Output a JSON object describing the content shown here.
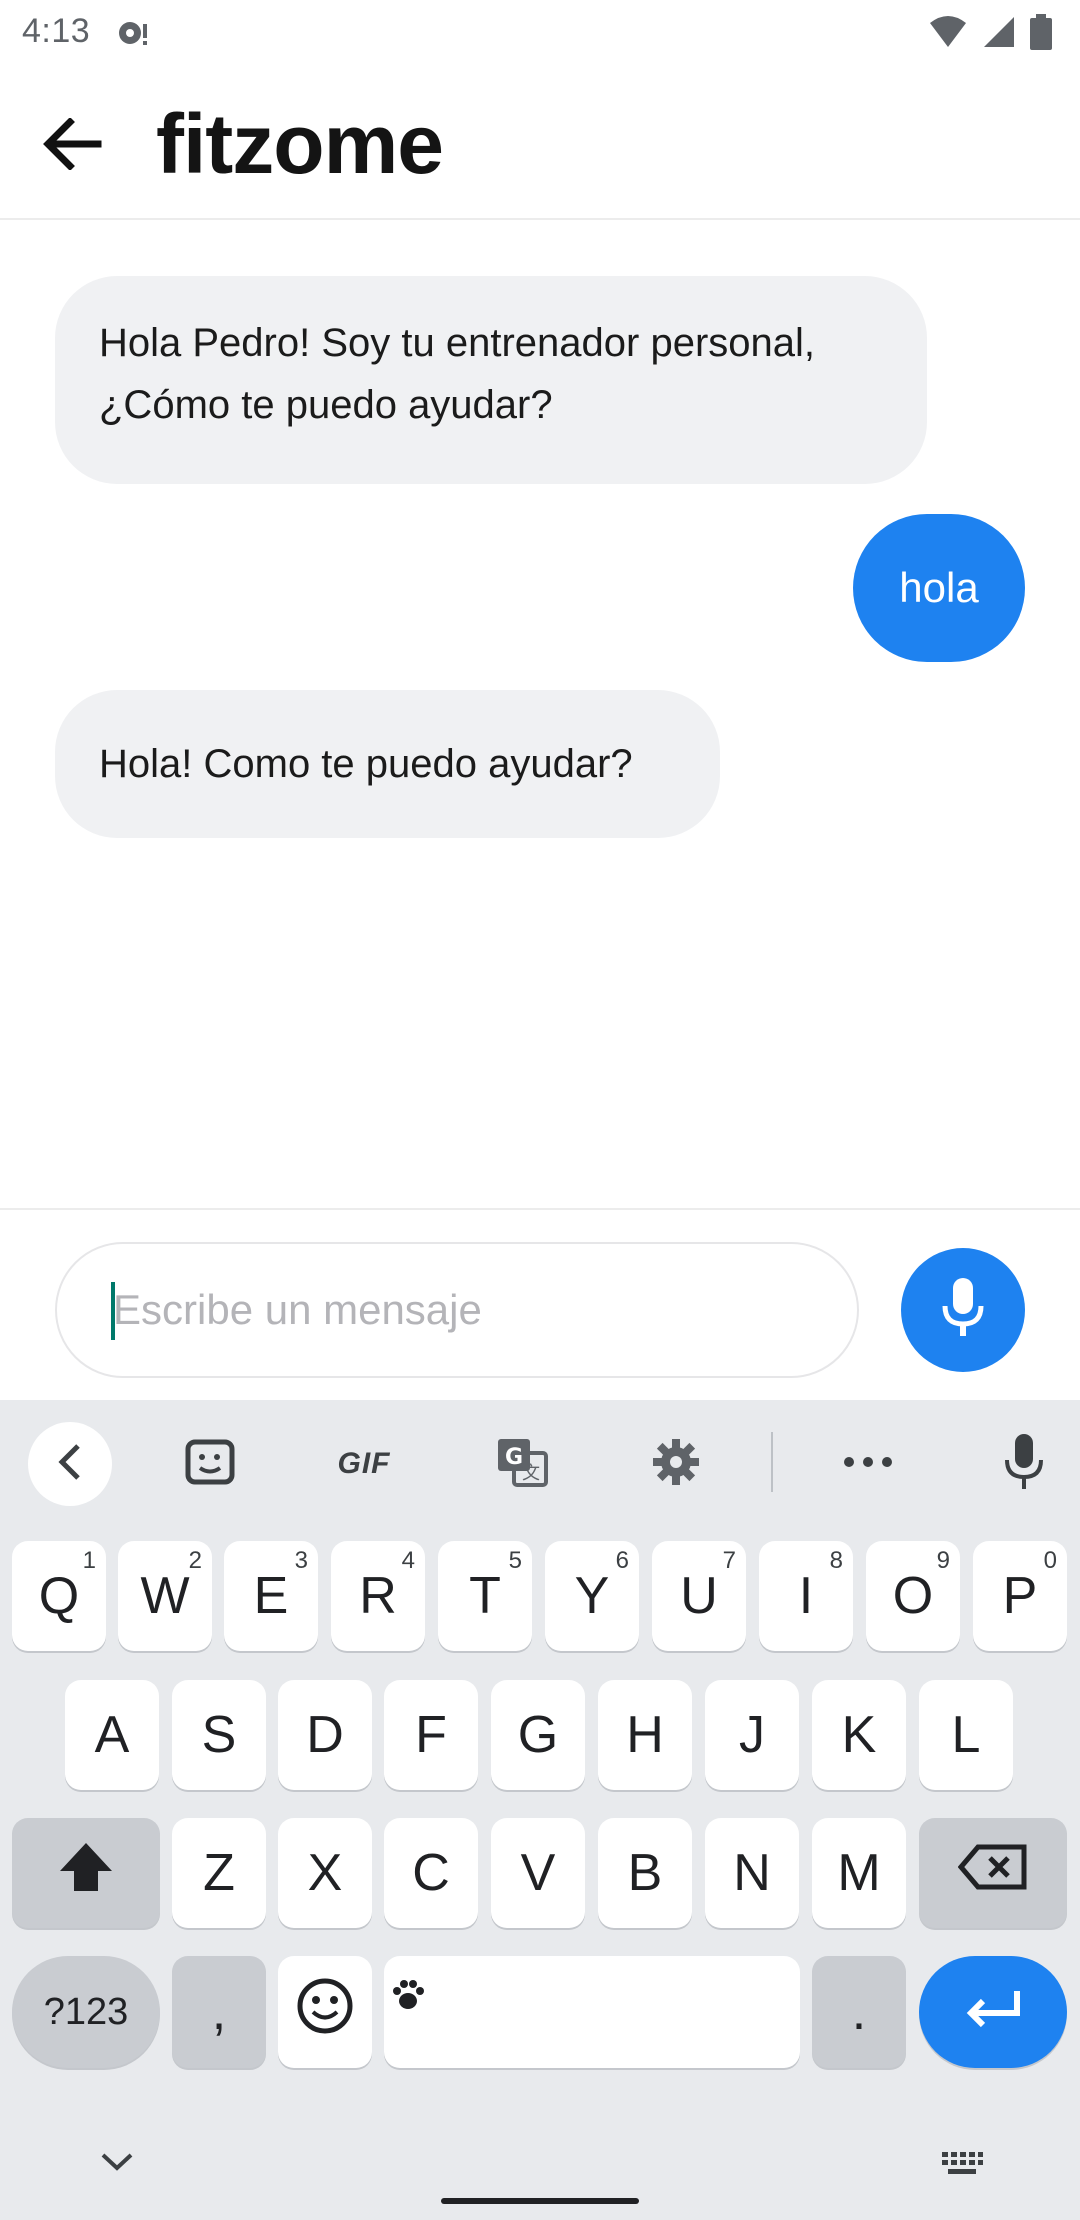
{
  "status_bar": {
    "time": "4:13",
    "icons": [
      "media-icon",
      "wifi-icon",
      "signal-icon",
      "battery-icon"
    ]
  },
  "app_bar": {
    "title": "fitzome",
    "back_icon": "arrow-left-icon"
  },
  "messages": [
    {
      "sender": "bot",
      "text": "Hola Pedro! Soy tu entrenador personal, ¿Cómo te puedo ayudar?"
    },
    {
      "sender": "user",
      "text": "hola"
    },
    {
      "sender": "bot",
      "text": "Hola! Como te puedo ayudar?"
    }
  ],
  "composer": {
    "placeholder": "Escribe un mensaje",
    "value": "",
    "mic_icon": "microphone-icon"
  },
  "keyboard": {
    "toolbar": {
      "gif_label": "GIF",
      "icons": [
        "chevron-left-icon",
        "sticker-icon",
        "gif-icon",
        "translate-icon",
        "settings-icon",
        "more-icon",
        "voice-input-icon"
      ]
    },
    "row1": [
      "Q",
      "W",
      "E",
      "R",
      "T",
      "Y",
      "U",
      "I",
      "O",
      "P"
    ],
    "row1_hints": [
      "1",
      "2",
      "3",
      "4",
      "5",
      "6",
      "7",
      "8",
      "9",
      "0"
    ],
    "row2": [
      "A",
      "S",
      "D",
      "F",
      "G",
      "H",
      "J",
      "K",
      "L"
    ],
    "row3": [
      "Z",
      "X",
      "C",
      "V",
      "B",
      "N",
      "M"
    ],
    "symbols_label": "?123",
    "comma": ",",
    "period": "."
  },
  "colors": {
    "accent": "#1e82f0",
    "bot_bubble": "#f0f1f3",
    "keyboard_bg": "#e8eaed"
  }
}
